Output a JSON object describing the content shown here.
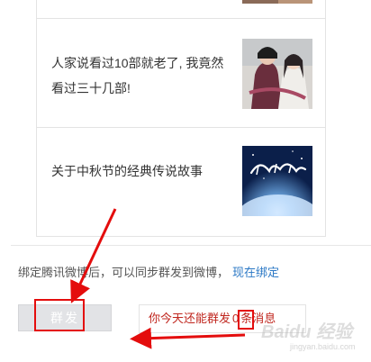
{
  "articles": [
    {
      "text": ""
    },
    {
      "text": "人家说看过10部就老了, 我竟然看过三十几部!",
      "thumb_icon": "drama-couple-photo"
    },
    {
      "text": "关于中秋节的经典传说故事",
      "thumb_icon": "moon-festival-image"
    }
  ],
  "weibo": {
    "bind_text": "绑定腾讯微博后，可以同步群发到微博，",
    "bind_link": "现在绑定"
  },
  "send": {
    "label": "群发"
  },
  "quota": {
    "prefix": "你今天还能群发",
    "count": "0",
    "suffix": "条消息"
  },
  "watermark": {
    "brand": "Baidu 经验",
    "sub": "jingyan.baidu.com"
  },
  "colors": {
    "accent_link": "#2b78c5",
    "annotation": "#e40d0d",
    "warn_text": "#c0271f"
  }
}
